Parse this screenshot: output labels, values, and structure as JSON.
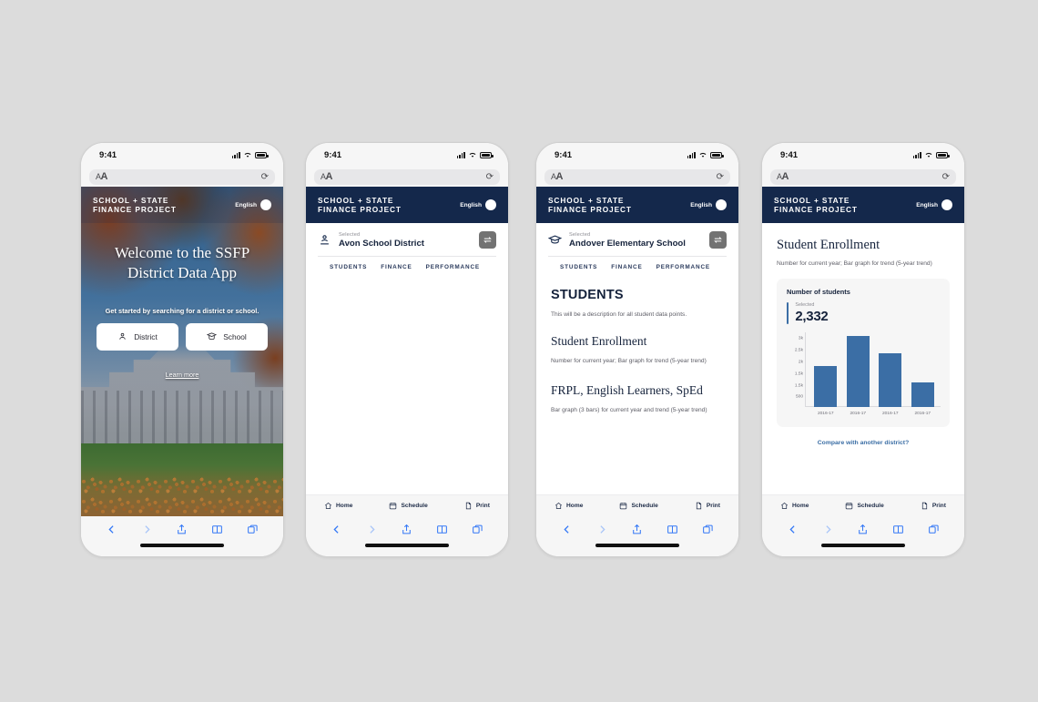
{
  "status_bar": {
    "time": "9:41",
    "signal_icon": "cellular-signal-icon",
    "wifi_icon": "wifi-icon",
    "battery_icon": "battery-icon"
  },
  "browser": {
    "aa_label": "A",
    "aa_label_big": "A",
    "reload_icon": "reload-icon",
    "back_icon": "back-chevron-icon",
    "forward_icon": "forward-chevron-icon",
    "share_icon": "share-icon",
    "bookmarks_icon": "book-icon",
    "tabs_icon": "tabs-icon"
  },
  "app_header": {
    "brand_line1": "SCHOOL + STATE",
    "brand_line2": "FINANCE PROJECT",
    "language_label": "English",
    "globe_icon": "globe-icon",
    "navy": "#14284b"
  },
  "app_nav": [
    {
      "label": "Home",
      "icon": "home-icon"
    },
    {
      "label": "Schedule",
      "icon": "calendar-icon"
    },
    {
      "label": "Print",
      "icon": "print-document-icon"
    }
  ],
  "tabs": [
    "STUDENTS",
    "FINANCE",
    "PERFORMANCE"
  ],
  "screen1": {
    "title": "Welcome to the SSFP District Data App",
    "cta": "Get started by searching for a district or school.",
    "district_button": "District",
    "school_button": "School",
    "district_icon": "person-pin-icon",
    "school_icon": "graduation-cap-icon",
    "learn_more": "Learn more"
  },
  "screen2": {
    "selected_label": "Selected",
    "selected_value": "Avon School District",
    "entity_icon": "district-pin-icon",
    "swap_icon": "swap-arrows-icon"
  },
  "screen3": {
    "selected_label": "Selected",
    "selected_value": "Andover Elementary School",
    "entity_icon": "school-cap-icon",
    "swap_icon": "swap-arrows-icon",
    "section_heading": "STUDENTS",
    "section_desc": "This will be a description for all student data points.",
    "block1_heading": "Student Enrollment",
    "block1_desc": "Number for current year; Bar graph for trend (5-year trend)",
    "block2_heading": "FRPL, English Learners, SpEd",
    "block2_desc": "Bar graph (3 bars) for current year and trend (5-year trend)"
  },
  "screen4": {
    "page_title": "Student Enrollment",
    "page_desc": "Number for current year; Bar graph for trend (5-year trend)",
    "card_title": "Number of students",
    "kpi_label": "Selected",
    "kpi_value": "2,332",
    "compare_link": "Compare with another district?",
    "accent": "#3b6ea5"
  },
  "chart_data": {
    "type": "bar",
    "title": "Number of students",
    "categories": [
      "2016-17",
      "2016-17",
      "2016-17",
      "2016-17"
    ],
    "values": [
      1750,
      3050,
      2300,
      1050
    ],
    "ytick_labels": [
      "3k",
      "2.5k",
      "2k",
      "1.5k",
      "1.5k",
      "500"
    ],
    "ytick_values": [
      3000,
      2500,
      2000,
      1500,
      1000,
      500
    ],
    "ylim": [
      0,
      3200
    ],
    "xlabel": "",
    "ylabel": "",
    "grid": false,
    "legend": "none",
    "bar_color": "#3b6ea5"
  }
}
